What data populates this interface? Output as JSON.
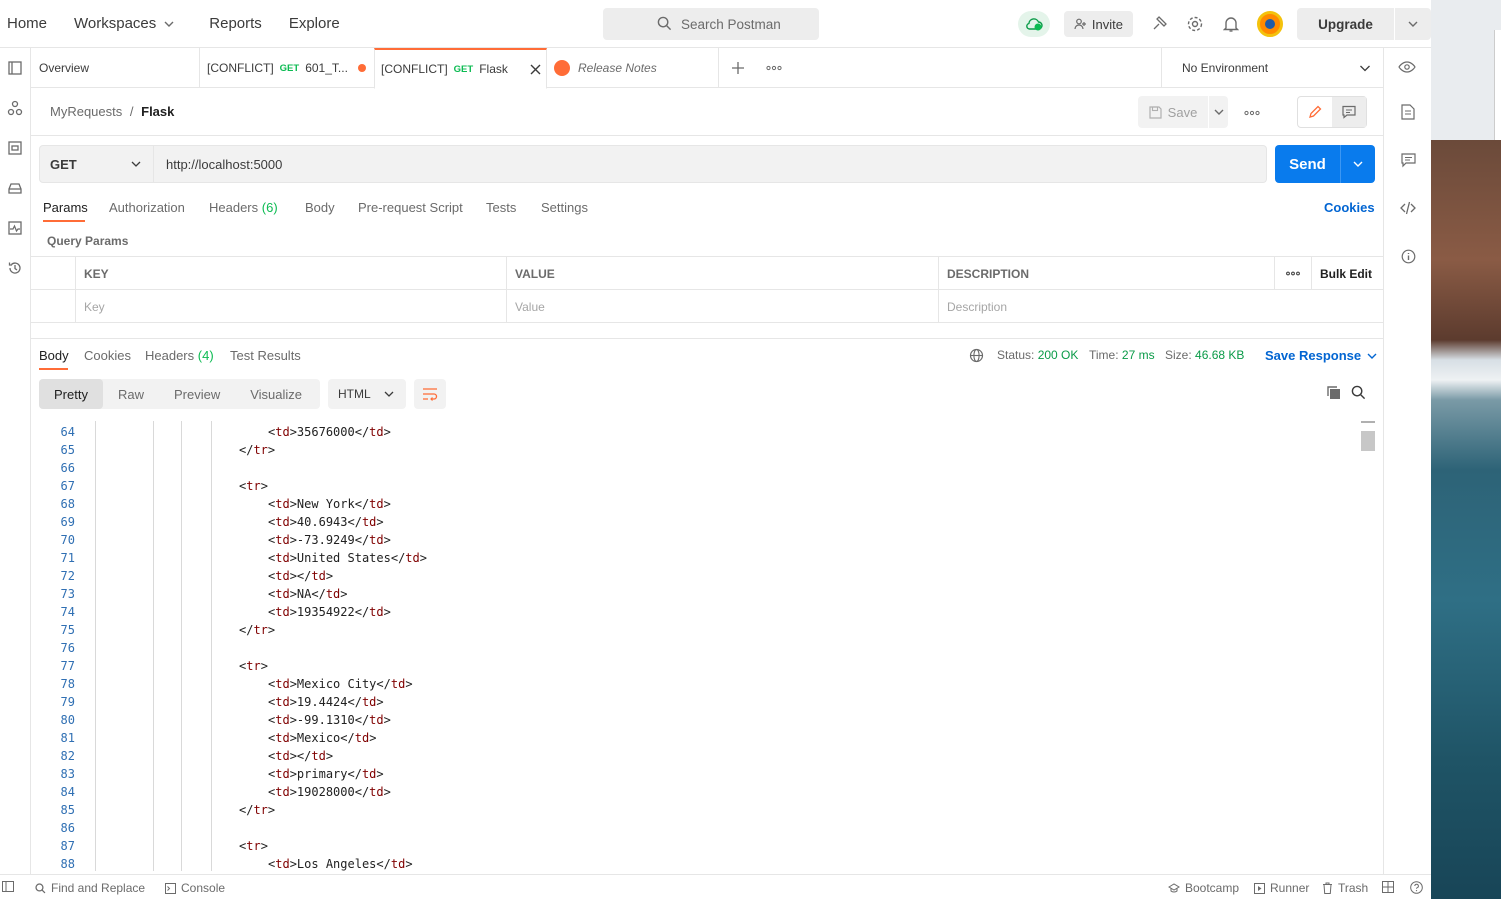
{
  "nav": {
    "home": "Home",
    "workspaces": "Workspaces",
    "reports": "Reports",
    "explore": "Explore",
    "search_placeholder": "Search Postman",
    "invite": "Invite",
    "upgrade": "Upgrade"
  },
  "tabs": [
    {
      "label": "Overview"
    },
    {
      "prefix": "[CONFLICT]",
      "method": "GET",
      "label": "601_T..."
    },
    {
      "prefix": "[CONFLICT]",
      "method": "GET",
      "label": "Flask"
    },
    {
      "label": "Release Notes"
    }
  ],
  "environment": "No Environment",
  "breadcrumb": {
    "parent": "MyRequests",
    "separator": "/",
    "current": "Flask"
  },
  "save_label": "Save",
  "request": {
    "method": "GET",
    "url": "http://localhost:5000",
    "send_label": "Send"
  },
  "request_tabs": {
    "params": "Params",
    "authorization": "Authorization",
    "headers": "Headers",
    "headers_count": "(6)",
    "body": "Body",
    "prerequest": "Pre-request Script",
    "tests": "Tests",
    "settings": "Settings",
    "cookies": "Cookies"
  },
  "query_params": {
    "label": "Query Params",
    "columns": [
      "KEY",
      "VALUE",
      "DESCRIPTION"
    ],
    "bulk_edit": "Bulk Edit",
    "placeholders": [
      "Key",
      "Value",
      "Description"
    ]
  },
  "response_tabs": {
    "body": "Body",
    "cookies": "Cookies",
    "headers": "Headers",
    "headers_count": "(4)",
    "test_results": "Test Results"
  },
  "response_meta": {
    "status_label": "Status:",
    "status_value": "200 OK",
    "time_label": "Time:",
    "time_value": "27 ms",
    "size_label": "Size:",
    "size_value": "46.68 KB",
    "save_response": "Save Response"
  },
  "view_modes": [
    "Pretty",
    "Raw",
    "Preview",
    "Visualize"
  ],
  "language": "HTML",
  "code_lines": [
    {
      "n": "64",
      "indent": 2,
      "text": "<td>35676000</td>"
    },
    {
      "n": "65",
      "indent": 1,
      "text": "</tr>"
    },
    {
      "n": "66",
      "indent": 0,
      "text": ""
    },
    {
      "n": "67",
      "indent": 1,
      "text": "<tr>"
    },
    {
      "n": "68",
      "indent": 2,
      "text": "<td>New York</td>"
    },
    {
      "n": "69",
      "indent": 2,
      "text": "<td>40.6943</td>"
    },
    {
      "n": "70",
      "indent": 2,
      "text": "<td>-73.9249</td>"
    },
    {
      "n": "71",
      "indent": 2,
      "text": "<td>United States</td>"
    },
    {
      "n": "72",
      "indent": 2,
      "text": "<td></td>"
    },
    {
      "n": "73",
      "indent": 2,
      "text": "<td>NA</td>"
    },
    {
      "n": "74",
      "indent": 2,
      "text": "<td>19354922</td>"
    },
    {
      "n": "75",
      "indent": 1,
      "text": "</tr>"
    },
    {
      "n": "76",
      "indent": 0,
      "text": ""
    },
    {
      "n": "77",
      "indent": 1,
      "text": "<tr>"
    },
    {
      "n": "78",
      "indent": 2,
      "text": "<td>Mexico City</td>"
    },
    {
      "n": "79",
      "indent": 2,
      "text": "<td>19.4424</td>"
    },
    {
      "n": "80",
      "indent": 2,
      "text": "<td>-99.1310</td>"
    },
    {
      "n": "81",
      "indent": 2,
      "text": "<td>Mexico</td>"
    },
    {
      "n": "82",
      "indent": 2,
      "text": "<td></td>"
    },
    {
      "n": "83",
      "indent": 2,
      "text": "<td>primary</td>"
    },
    {
      "n": "84",
      "indent": 2,
      "text": "<td>19028000</td>"
    },
    {
      "n": "85",
      "indent": 1,
      "text": "</tr>"
    },
    {
      "n": "86",
      "indent": 0,
      "text": ""
    },
    {
      "n": "87",
      "indent": 1,
      "text": "<tr>"
    },
    {
      "n": "88",
      "indent": 2,
      "text": "<td>Los Angeles</td>"
    }
  ],
  "footer": {
    "find_replace": "Find and Replace",
    "console": "Console",
    "bootcamp": "Bootcamp",
    "runner": "Runner",
    "trash": "Trash"
  },
  "colors": {
    "accent": "#ff6c37",
    "send": "#097bed",
    "link": "#0265d2",
    "success": "#0cbb52"
  }
}
